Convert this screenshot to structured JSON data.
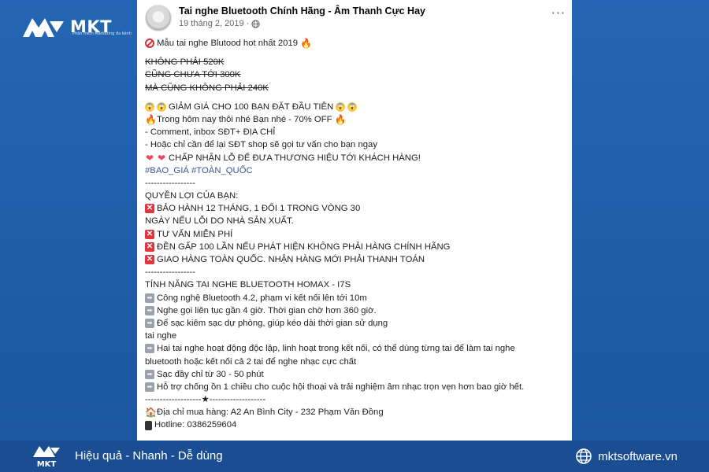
{
  "brand": {
    "logo_text": "MKT",
    "logo_sub": "Phần mềm Marketing đa kênh"
  },
  "post": {
    "page_name": "Tai nghe Bluetooth Chính Hãng - Âm Thanh Cực Hay",
    "date": "19 tháng 2, 2019 ·",
    "more_icon": "more-dots-icon",
    "lines": [
      {
        "icon": "no-entry",
        "text": "Mẫu tai nghe Blutood hot nhất 2019",
        "icon_after": "fire"
      },
      {
        "gap": true
      },
      {
        "text": "KHÔNG PHẢI 520K",
        "strike": true
      },
      {
        "text": "CŨNG CHƯA TỚI 300K",
        "strike": true
      },
      {
        "text": "MÀ CŨNG KHÔNG PHẢI 240K",
        "strike": true
      },
      {
        "gap": true
      },
      {
        "icon": "scream",
        "icon2": "scream",
        "text": "GIẢM GIÁ CHO 100 BẠN ĐẶT ĐẦU TIÊN",
        "icon_after": "scream",
        "icon_after2": "scream"
      },
      {
        "icon": "fire",
        "text": "Trong hôm nay thôi nhé Bạn nhé - 70% OFF",
        "icon_after": "fire"
      },
      {
        "text": "- Comment, inbox SĐT+ ĐỊA CHỈ"
      },
      {
        "text": "- Hoặc chỉ cần để lại SĐT shop sẽ gọi tư vấn cho bạn ngay"
      },
      {
        "icon": "heart",
        "icon2": "heart",
        "text": "CHẤP NHẬN LỖ ĐỂ ĐƯA THƯƠNG HIỆU TỚI KHÁCH HÀNG!"
      },
      {
        "text": "#BAO_GIÁ #TOÀN_QUỐC",
        "tag": true
      },
      {
        "text": "-----------------"
      },
      {
        "text": "QUYỀN LỢI CỦA BẠN:"
      },
      {
        "icon": "x",
        "text": "BẢO HÀNH 12 THÁNG, 1 ĐỔI 1 TRONG VÒNG 30"
      },
      {
        "text": "NGÀY NẾU LỖI DO NHÀ SẢN XUẤT."
      },
      {
        "icon": "x",
        "text": "TƯ VẤN MIỄN PHÍ"
      },
      {
        "icon": "x",
        "text": "ĐỀN GẤP 100 LẦN NẾU PHÁT HIỆN KHÔNG PHẢI HÀNG CHÍNH HÃNG"
      },
      {
        "icon": "x",
        "text": "GIAO HÀNG TOÀN QUỐC. NHẬN HÀNG MỚI PHẢI THANH TOÁN"
      },
      {
        "text": "-----------------"
      },
      {
        "text": "TÍNH NĂNG TAI NGHE BLUETOOTH HOMAX - I7S"
      },
      {
        "icon": "arrow",
        "text": "Công nghệ Bluetooth 4.2, phạm vi kết nối lên tới 10m"
      },
      {
        "icon": "arrow",
        "text": "Nghe gọi liên tục gần 4 giờ. Thời gian chờ hơn 360 giờ."
      },
      {
        "icon": "arrow",
        "text": "Để sạc kiêm sạc dự phòng, giúp kéo dài thời gian sử dụng"
      },
      {
        "text": "tai nghe"
      },
      {
        "icon": "arrow",
        "text": "Hai tai nghe hoạt động độc lập, linh hoạt trong kết nối, có thể dùng từng tai để làm tai nghe"
      },
      {
        "text": "bluetooth hoặc kết nối cả 2 tai để nghe nhạc cực chất"
      },
      {
        "icon": "arrow",
        "text": "Sạc đầy chỉ từ 30 - 50 phút"
      },
      {
        "icon": "arrow",
        "text": "Hỗ trợ chống ồn 1 chiều cho cuộc hội thoại và trải nghiệm âm nhạc trọn vẹn hơn bao giờ hết."
      },
      {
        "text": "-------------------★-------------------"
      },
      {
        "icon": "house",
        "text": "Địa chỉ mua hàng: A2 An Bình City - 232 Phạm Văn Đồng"
      },
      {
        "icon": "phone",
        "text": "Hotline: 0386259604"
      }
    ]
  },
  "footer": {
    "tagline": "Hiệu quả - Nhanh - Dễ dùng",
    "website": "mktsoftware.vn",
    "website_icon": "globe-icon"
  },
  "colors": {
    "background": "#1f5aa6",
    "footer": "#1a4d91",
    "hashtag": "#385898",
    "red_x": "#e2353f"
  }
}
